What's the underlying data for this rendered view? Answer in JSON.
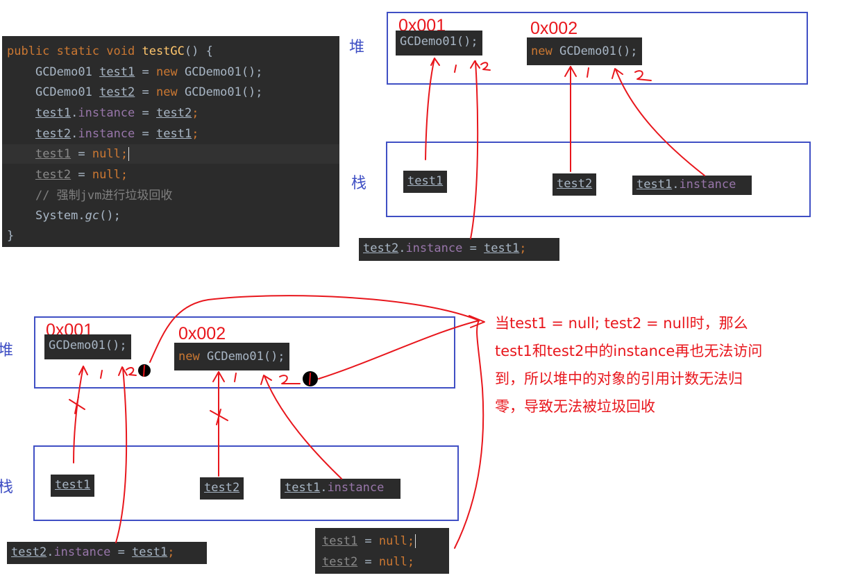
{
  "code": {
    "signature": {
      "kw": "public static void ",
      "fn": "testGC",
      "rest": "() {"
    },
    "line1": {
      "type": "GCDemo01 ",
      "var": "test1",
      "eq": " = ",
      "kw": "new",
      "rest": " GCDemo01();"
    },
    "line2": {
      "type": "GCDemo01 ",
      "var": "test2",
      "eq": " = ",
      "kw": "new",
      "rest": " GCDemo01();"
    },
    "line3": {
      "var": "test1",
      "dot": ".",
      "field": "instance",
      "eq": " = ",
      "var2": "test2",
      "semi": ";"
    },
    "line4": {
      "var": "test2",
      "dot": ".",
      "field": "instance",
      "eq": " = ",
      "var2": "test1",
      "semi": ";"
    },
    "line5": {
      "var": "test1",
      "eq": " = ",
      "kw": "null",
      "semi": ";"
    },
    "line6": {
      "var": "test2",
      "eq": " = ",
      "kw": "null",
      "semi": ";"
    },
    "comment": "// 强制jvm进行垃圾回收",
    "gc_call": {
      "obj": "System.",
      "method": "gc",
      "rest": "();"
    },
    "closing": "}"
  },
  "labels": {
    "heap": "堆",
    "stack": "栈"
  },
  "diagram1": {
    "addr1": "0x001",
    "addr2": "0x002",
    "obj1": "GCDemo01();",
    "obj2": {
      "kw": "new",
      "rest": " GCDemo01();"
    },
    "test1": "test1",
    "test2": "test2",
    "instance_ref": {
      "var": "test1",
      "dot": ".",
      "field": "instance"
    },
    "assign": {
      "var": "test2",
      "dot": ".",
      "field": "instance",
      "eq": " = ",
      "var2": "test1",
      "semi": ";"
    }
  },
  "diagram2": {
    "addr1": "0x001",
    "addr2": "0x002",
    "obj1": "GCDemo01();",
    "obj2": {
      "kw": "new",
      "rest": " GCDemo01();"
    },
    "test1": "test1",
    "test2": "test2",
    "instance_ref": {
      "var": "test1",
      "dot": ".",
      "field": "instance"
    },
    "assign": {
      "var": "test2",
      "dot": ".",
      "field": "instance",
      "eq": " = ",
      "var2": "test1",
      "semi": ";"
    },
    "null1": {
      "var": "test1",
      "eq": " = ",
      "kw": "null",
      "semi": ";"
    },
    "null2": {
      "var": "test2",
      "eq": " = ",
      "kw": "null",
      "semi": ";"
    }
  },
  "note": {
    "line1": "当test1 = null; test2 = null时，那么",
    "line2": "test1和test2中的instance再也无法访问",
    "line3": "到，所以堆中的对象的引用计数无法归",
    "line4": "零，导致无法被垃圾回收"
  },
  "colors": {
    "ink": "#e8161c",
    "frame": "#3f4fc4",
    "code_bg": "#2b2b2b"
  }
}
